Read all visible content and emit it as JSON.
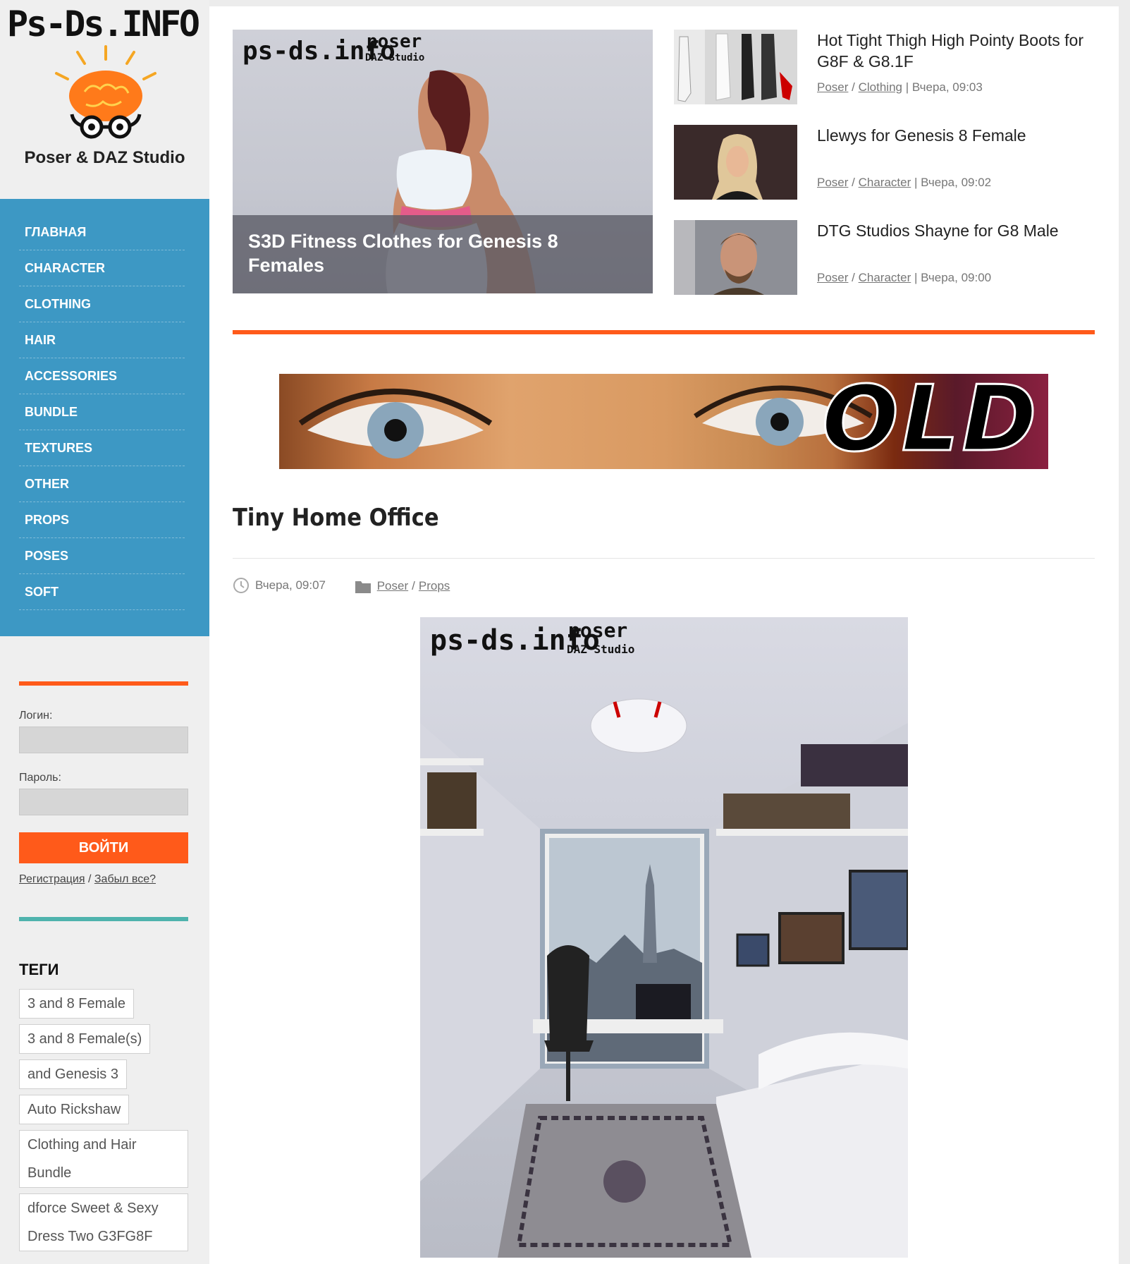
{
  "site": {
    "logo_text": "Ps-Ds.INFO",
    "logo_subtitle": "Poser & DAZ Studio"
  },
  "menu": [
    {
      "label": "ГЛАВНАЯ"
    },
    {
      "label": "CHARACTER"
    },
    {
      "label": "CLOTHING"
    },
    {
      "label": "HAIR"
    },
    {
      "label": "ACCESSORIES"
    },
    {
      "label": "BUNDLE"
    },
    {
      "label": "TEXTURES"
    },
    {
      "label": "OTHER"
    },
    {
      "label": "PROPS"
    },
    {
      "label": "POSES"
    },
    {
      "label": "SOFT"
    }
  ],
  "login": {
    "login_label": "Логин:",
    "password_label": "Пароль:",
    "submit_label": "ВОЙТИ",
    "register_link": "Регистрация",
    "separator": "/",
    "forgot_link": "Забыл все?"
  },
  "tags": {
    "title": "ТЕГИ",
    "items": [
      "3 and 8 Female",
      "3 and 8 Female(s)",
      "and Genesis 3",
      "Auto Rickshaw",
      "Clothing and Hair Bundle",
      "dforce Sweet & Sexy Dress Two G3FG8F"
    ]
  },
  "watermark": {
    "site": "ps-ds.info",
    "poser": "poser",
    "daz": "DAZ Studio"
  },
  "hero": {
    "caption": "S3D Fitness Clothes for Genesis 8 Females"
  },
  "side_news": [
    {
      "title": "Hot Tight Thigh High Pointy Boots for G8F & G8.1F",
      "cat1": "Poser",
      "cat2": "Clothing",
      "date": "| Вчера, 09:03"
    },
    {
      "title": "Llewys for Genesis 8 Female",
      "cat1": "Poser",
      "cat2": "Character",
      "date": "| Вчера, 09:02"
    },
    {
      "title": "DTG Studios Shayne for G8 Male",
      "cat1": "Poser",
      "cat2": "Character",
      "date": "| Вчера, 09:00"
    }
  ],
  "banner": {
    "text": "OLD"
  },
  "post": {
    "title": "Tiny Home Office",
    "date": "Вчера, 09:07",
    "cat1": "Poser",
    "sep": "/",
    "cat2": "Props"
  },
  "colors": {
    "accent_orange": "#ff5a1a",
    "menu_blue": "#3d98c4",
    "teal": "#4fb3ad"
  }
}
